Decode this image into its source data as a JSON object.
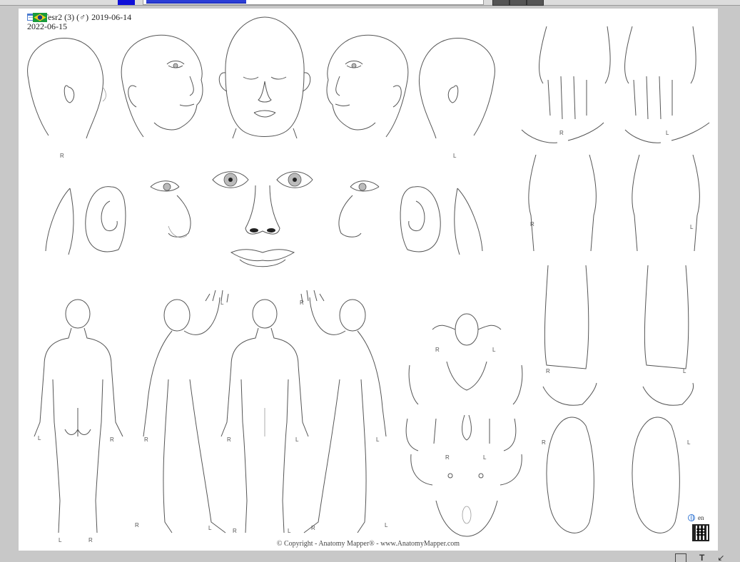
{
  "patient": {
    "name_line": "Test Tesr2 (3) (♂)",
    "birth_date": "2019-06-14",
    "visit_date": "2022-06-15"
  },
  "labels": {
    "right": "R",
    "left": "L"
  },
  "language": "en",
  "copyright": "© Copyright - Anatomy Mapper® - www.AnatomyMapper.com",
  "toolbar": {
    "accent": "#1010d8",
    "slider_fill_color": "#2c3ed6"
  },
  "icons": {
    "birthday": "cake-icon",
    "visit": "calendar-icon",
    "country": "brazil-flag-icon",
    "language": "globe-icon",
    "qr": "qr-code-icon"
  }
}
